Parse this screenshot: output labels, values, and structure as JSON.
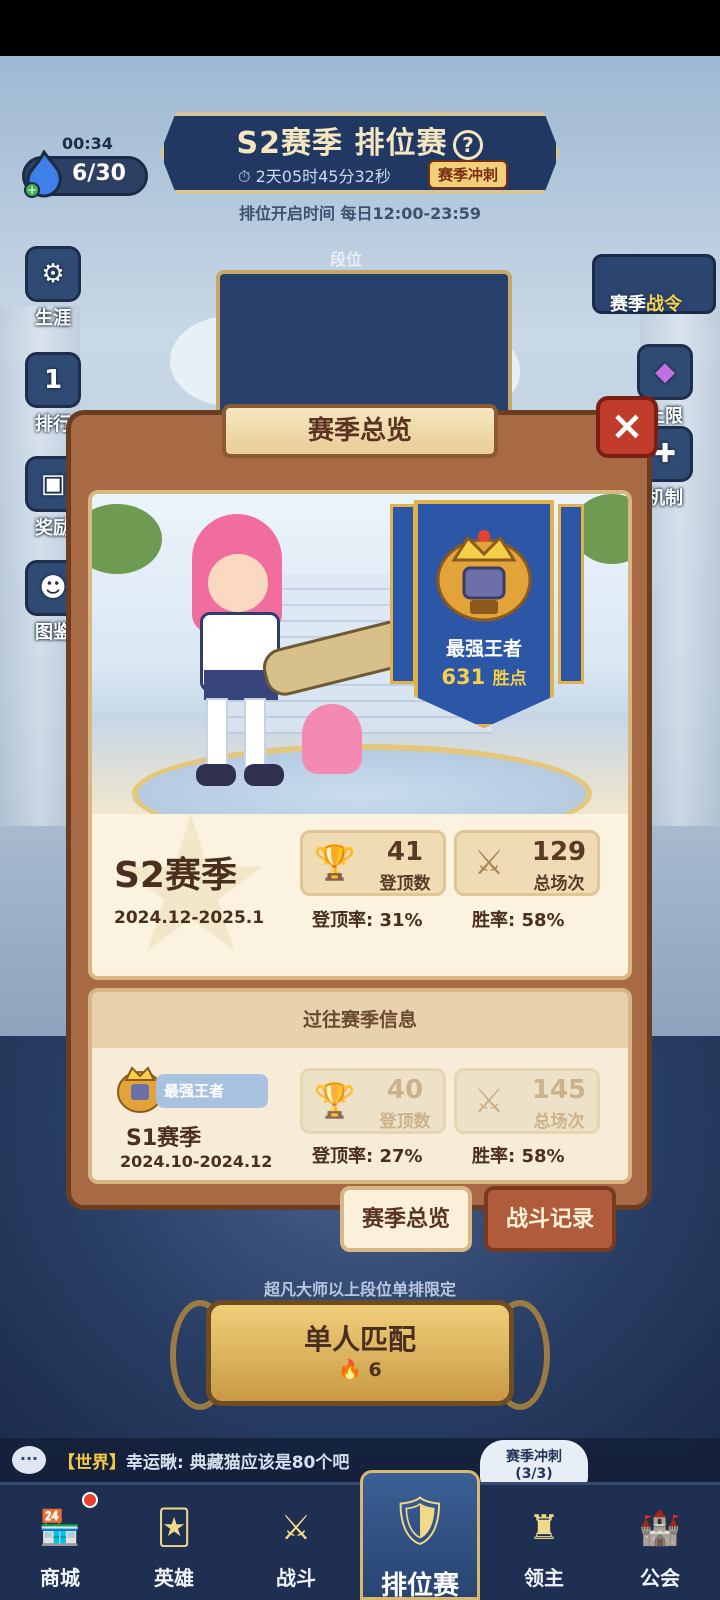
{
  "hud": {
    "timer": "00:34",
    "energy": "6/30",
    "season_title": "S2赛季 排位赛",
    "countdown": "2天05时45分32秒",
    "sprint_tag": "赛季冲刺",
    "open_hours": "排位开启时间 每日12:00-23:59",
    "rank_label": "段位"
  },
  "side_left": [
    {
      "label": "生涯",
      "icon": "career-icon"
    },
    {
      "label": "排行",
      "icon": "leaderboard-icon"
    },
    {
      "label": "奖励",
      "icon": "reward-icon"
    },
    {
      "label": "图鉴",
      "icon": "codex-icon"
    }
  ],
  "side_right": {
    "pass_label_a": "赛季",
    "pass_label_b": "战令",
    "limit_label": "上限",
    "mech_label": "机制"
  },
  "modal": {
    "title": "赛季总览",
    "close": "×",
    "banner_title": "最强王者",
    "banner_points": "631",
    "banner_points_unit": "胜点",
    "current": {
      "season": "S2赛季",
      "dates": "2024.12-2025.1",
      "peak_count": "41",
      "peak_label": "登顶数",
      "total_count": "129",
      "total_label": "总场次",
      "peak_rate": "登顶率: 31%",
      "win_rate": "胜率: 58%"
    },
    "past_header": "过往赛季信息",
    "past": {
      "rank": "最强王者",
      "season": "S1赛季",
      "dates": "2024.10-2024.12",
      "peak_count": "40",
      "peak_label": "登顶数",
      "total_count": "145",
      "total_label": "总场次",
      "peak_rate": "登顶率: 27%",
      "win_rate": "胜率: 58%"
    },
    "tabs": {
      "overview": "赛季总览",
      "records": "战斗记录"
    }
  },
  "match": {
    "limit_text": "超凡大师以上段位单排限定",
    "button": "单人匹配",
    "cost": "6"
  },
  "chat": {
    "channel": "【世界】",
    "message": "幸运瞅: 典藏猫应该是80个吧",
    "sprint_bubble_a": "赛季冲刺",
    "sprint_bubble_b": "(3/3)"
  },
  "nav": [
    {
      "label": "商城",
      "icon": "shop-icon"
    },
    {
      "label": "英雄",
      "icon": "heroes-icon"
    },
    {
      "label": "战斗",
      "icon": "battle-icon"
    },
    {
      "label": "排位赛",
      "icon": "ranked-icon"
    },
    {
      "label": "领主",
      "icon": "lord-icon"
    },
    {
      "label": "公会",
      "icon": "guild-icon"
    }
  ],
  "colors": {
    "accent_gold": "#f6cf4a",
    "banner_blue": "#2c57a6",
    "close_red": "#c23c2c"
  }
}
